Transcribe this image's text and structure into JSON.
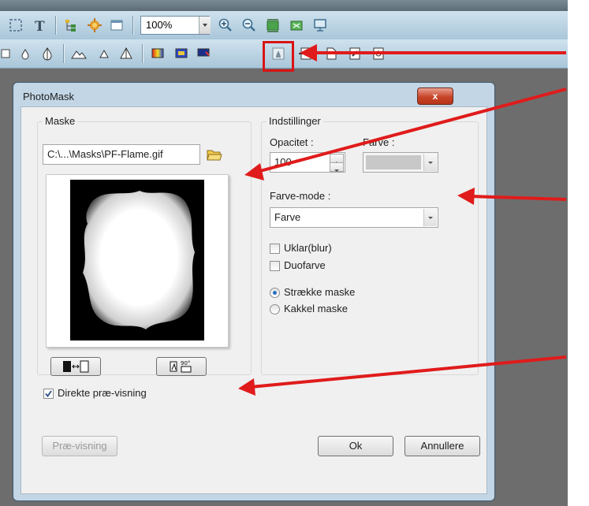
{
  "toolbar": {
    "zoom_value": "100%"
  },
  "dialog": {
    "title": "PhotoMask",
    "close_label": "x",
    "mask_group": {
      "label": "Maske",
      "file_path": "C:\\...\\Masks\\PF-Flame.gif"
    },
    "settings_group": {
      "label": "Indstillinger",
      "opacity_label": "Opacitet :",
      "opacity_value": "100",
      "color_label": "Farve :",
      "color_value_hex": "#c8c8c8",
      "color_mode_label": "Farve-mode :",
      "color_mode_value": "Farve",
      "blur_label": "Uklar(blur)",
      "duotone_label": "Duofarve",
      "stretch_label": "Strække maske",
      "tile_label": "Kakkel maske"
    },
    "live_preview_label": "Direkte præ-visning",
    "preview_button": "Præ-visning",
    "ok_button": "Ok",
    "cancel_button": "Annullere"
  },
  "colors": {
    "annotation_red": "#e01b1b",
    "toolbar_blue": "#b9d3e4"
  }
}
